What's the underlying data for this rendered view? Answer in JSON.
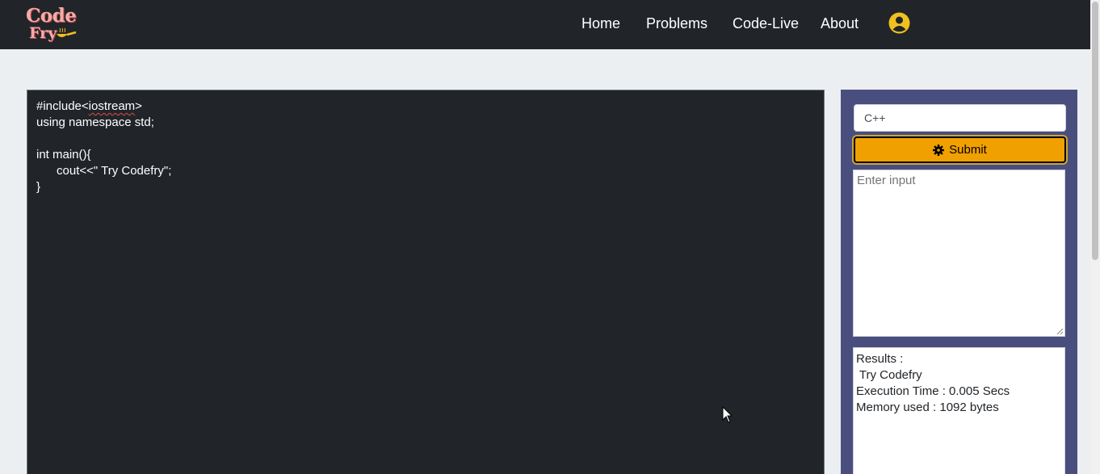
{
  "logo": {
    "line1": "Code",
    "line2": "Fry"
  },
  "nav": {
    "links": [
      {
        "label": "Home"
      },
      {
        "label": "Problems"
      },
      {
        "label": "Code-Live"
      },
      {
        "label": "About"
      }
    ],
    "avatar_icon": "user-circle-icon"
  },
  "editor": {
    "lines": [
      "#include<iostream>",
      "using namespace std;",
      "",
      "int main(){",
      "      cout<<\" Try Codefry\";",
      "}"
    ]
  },
  "sidebar": {
    "language": "C++",
    "submit_label": "Submit",
    "submit_icon": "gear-icon",
    "input_placeholder": "Enter input",
    "results": {
      "heading": "Results :",
      "output": " Try Codefry",
      "execution_time": "Execution Time : 0.005 Secs",
      "memory": "Memory used : 1092 bytes"
    }
  },
  "colors": {
    "navbar": "#212529",
    "editor_bg": "#212529",
    "sidebar_bg": "#4a4e7e",
    "submit_bg": "#f0a000",
    "logo_text": "#f7a8a8"
  }
}
